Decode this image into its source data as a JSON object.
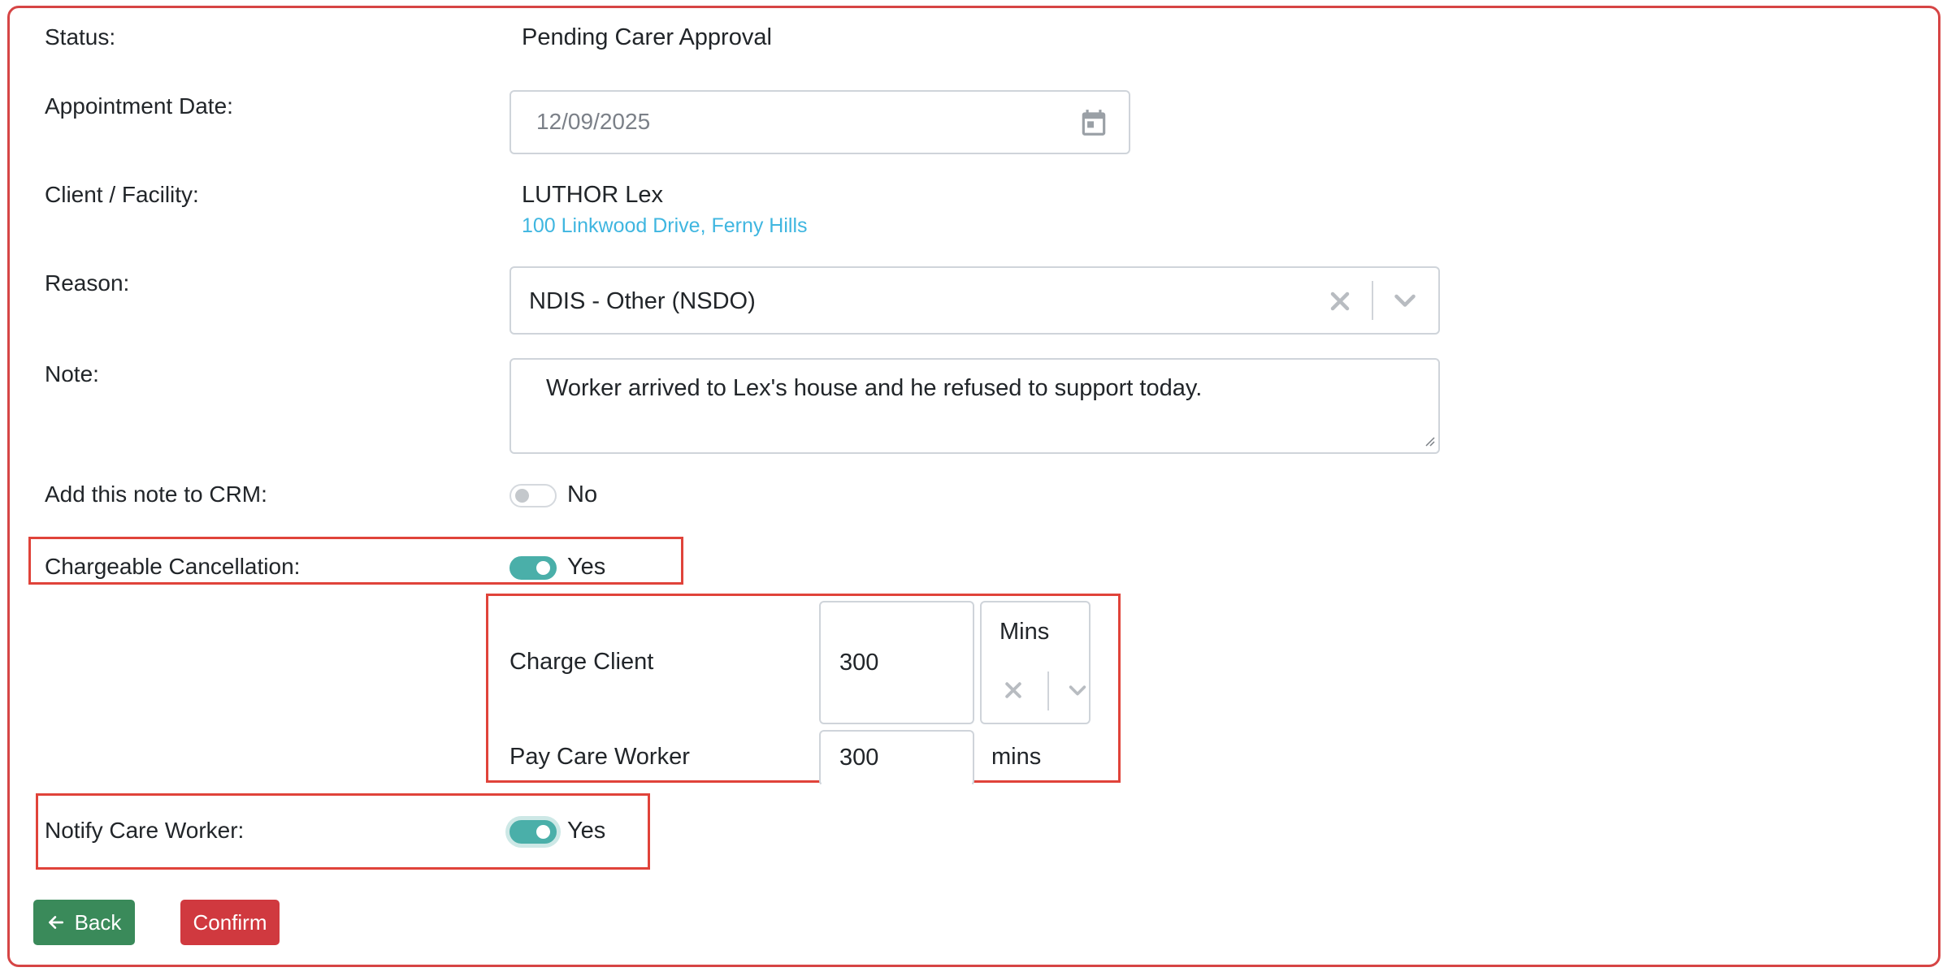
{
  "form": {
    "status_label": "Status:",
    "status_value": "Pending Carer Approval",
    "date_label": "Appointment Date:",
    "date_value": "12/09/2025",
    "client_label": "Client / Facility:",
    "client_name": "LUTHOR Lex",
    "client_address": "100 Linkwood Drive, Ferny Hills",
    "reason_label": "Reason:",
    "reason_value": "NDIS - Other (NSDO)",
    "note_label": "Note:",
    "note_value": "Worker arrived to Lex's house and he refused to support today.",
    "crm_label": "Add this note to CRM:",
    "crm_value": "No",
    "chargeable_label": "Chargeable Cancellation:",
    "chargeable_value": "Yes",
    "charge_client_label": "Charge Client",
    "charge_client_value": "300",
    "charge_unit": "Mins",
    "pay_worker_label": "Pay Care Worker",
    "pay_worker_value": "300",
    "pay_unit": "mins",
    "notify_label": "Notify Care Worker:",
    "notify_value": "Yes"
  },
  "actions": {
    "back_label": "Back",
    "confirm_label": "Confirm"
  },
  "colors": {
    "frame_border": "#d64545",
    "highlight": "#e0433a",
    "toggle_on": "#4aafa9",
    "back_button": "#3a8a5a",
    "confirm_button": "#d0393f",
    "link": "#3fb6e0"
  },
  "icons": {
    "date": "calendar-icon",
    "clear": "clear-x-icon",
    "dropdown": "chevron-down-icon",
    "back": "arrow-left-icon",
    "resize": "resize-handle-icon"
  }
}
